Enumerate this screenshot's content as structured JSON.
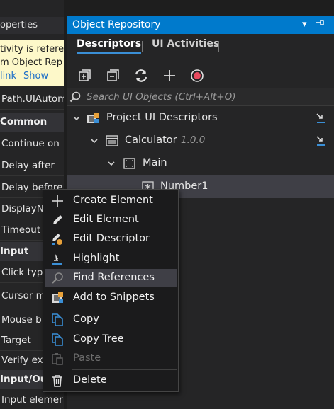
{
  "properties": {
    "title": "operties",
    "info_lines": [
      "tivity is refere",
      "m Object Rep"
    ],
    "info_links": [
      "link",
      "Show"
    ],
    "path_row": "Path.UIAutom",
    "categories": {
      "common": "Common",
      "input": "Input",
      "input_output": "Input/Ou"
    },
    "rows": {
      "continue_on": "Continue on",
      "delay_after": "Delay after",
      "delay_before": "Delay before",
      "display_name": "DisplayN",
      "timeout": "Timeout",
      "click_type": "Click type",
      "cursor": "Cursor m",
      "mouse": "Mouse b",
      "target": "Target",
      "verify": "Verify exe",
      "input_element": "Input elemer"
    }
  },
  "repo": {
    "title": "Object Repository",
    "pin_glyph": "⊣",
    "menu_glyph": "▾",
    "tabs": [
      "Descriptors",
      "UI Activities"
    ],
    "search_placeholder": "Search UI Objects (Ctrl+Alt+O)",
    "tree": {
      "project": "Project UI Descriptors",
      "app": "Calculator",
      "app_version": "1.0.0",
      "screen": "Main",
      "element": "Number1"
    }
  },
  "context_menu": {
    "items": {
      "create": "Create Element",
      "edit": "Edit Element",
      "edit_descriptor": "Edit Descriptor",
      "highlight": "Highlight",
      "find_refs": "Find References",
      "snippets": "Add to Snippets",
      "copy": "Copy",
      "copy_tree": "Copy Tree",
      "paste": "Paste",
      "delete": "Delete"
    }
  },
  "colors": {
    "accent": "#007acc",
    "record": "#e84a5f",
    "copy_blue": "#3a8fd6"
  }
}
